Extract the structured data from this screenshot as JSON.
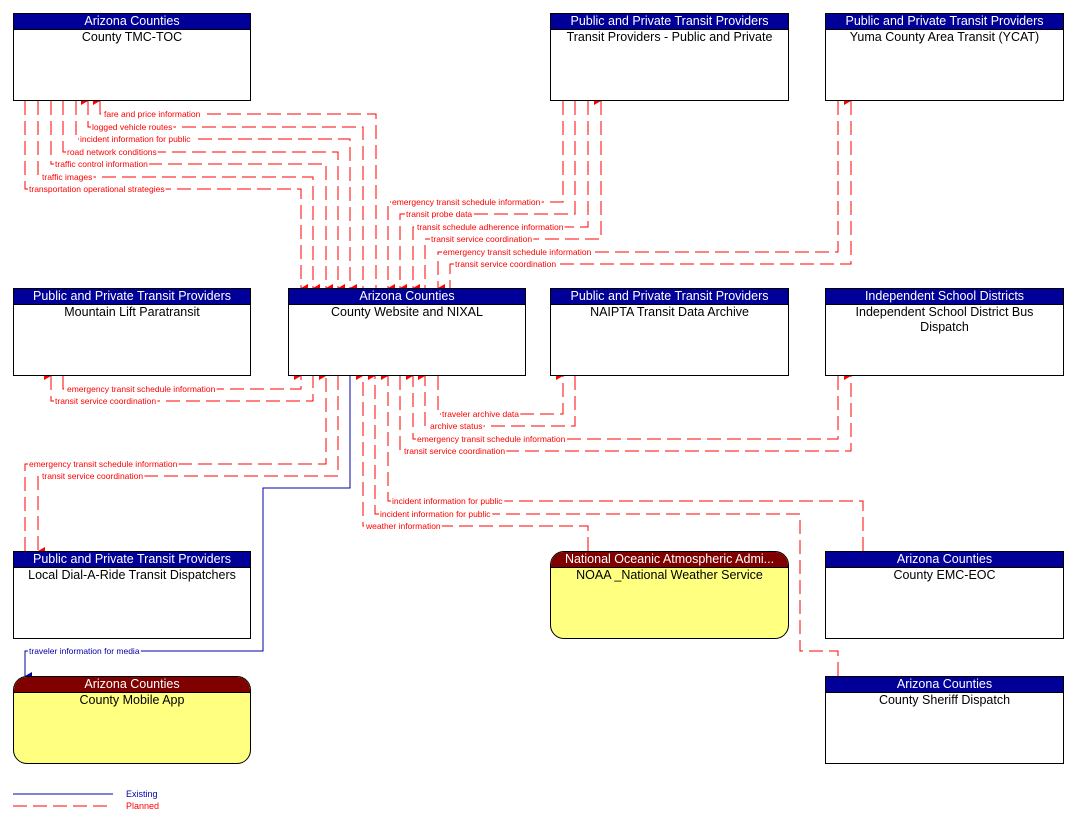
{
  "colors": {
    "planned": "#ff0000",
    "existing": "#0000aa",
    "header_subsystem": "#000099",
    "header_terminator": "#800000",
    "terminator_fill": "#ffff80"
  },
  "nodes": {
    "tmc": {
      "group": "Arizona Counties",
      "name": "County TMC-TOC"
    },
    "transit_providers": {
      "group": "Public and Private Transit Providers",
      "name": "Transit Providers - Public and Private"
    },
    "ycat": {
      "group": "Public and Private Transit Providers",
      "name": "Yuma County Area Transit (YCAT)"
    },
    "mountain_lift": {
      "group": "Public and Private Transit Providers",
      "name": "Mountain Lift Paratransit"
    },
    "website": {
      "group": "Arizona Counties",
      "name": "County Website and NIXAL"
    },
    "naipta": {
      "group": "Public and Private Transit Providers",
      "name": "NAIPTA Transit Data Archive"
    },
    "school": {
      "group": "Independent School Districts",
      "name": "Independent School District Bus Dispatch"
    },
    "dial_a_ride": {
      "group": "Public and Private Transit Providers",
      "name": "Local Dial-A-Ride Transit Dispatchers"
    },
    "noaa": {
      "group": "National Oceanic Atmospheric Admi...",
      "name": "NOAA _National Weather Service"
    },
    "emc": {
      "group": "Arizona Counties",
      "name": "County EMC-EOC"
    },
    "mobile_app": {
      "group": "Arizona Counties",
      "name": "County Mobile App"
    },
    "sheriff": {
      "group": "Arizona Counties",
      "name": "County Sheriff Dispatch"
    }
  },
  "flows": [
    {
      "label": "fare and price information",
      "status": "planned"
    },
    {
      "label": "logged vehicle routes",
      "status": "planned"
    },
    {
      "label": "incident information for public",
      "status": "planned"
    },
    {
      "label": "road network conditions",
      "status": "planned"
    },
    {
      "label": "traffic control information",
      "status": "planned"
    },
    {
      "label": "traffic images",
      "status": "planned"
    },
    {
      "label": "transportation operational strategies",
      "status": "planned"
    },
    {
      "label": "emergency transit schedule information",
      "status": "planned"
    },
    {
      "label": "transit probe data",
      "status": "planned"
    },
    {
      "label": "transit schedule adherence information",
      "status": "planned"
    },
    {
      "label": "transit service coordination",
      "status": "planned"
    },
    {
      "label": "emergency transit schedule information",
      "status": "planned"
    },
    {
      "label": "transit service coordination",
      "status": "planned"
    },
    {
      "label": "emergency transit schedule information",
      "status": "planned"
    },
    {
      "label": "transit service coordination",
      "status": "planned"
    },
    {
      "label": "traveler archive data",
      "status": "planned"
    },
    {
      "label": "archive status",
      "status": "planned"
    },
    {
      "label": "emergency transit schedule information",
      "status": "planned"
    },
    {
      "label": "transit service coordination",
      "status": "planned"
    },
    {
      "label": "emergency transit schedule information",
      "status": "planned"
    },
    {
      "label": "transit service coordination",
      "status": "planned"
    },
    {
      "label": "incident information for public",
      "status": "planned"
    },
    {
      "label": "incident information for public",
      "status": "planned"
    },
    {
      "label": "weather information",
      "status": "planned"
    },
    {
      "label": "traveler information for media",
      "status": "existing"
    }
  ],
  "legend": {
    "existing": "Existing",
    "planned": "Planned"
  }
}
